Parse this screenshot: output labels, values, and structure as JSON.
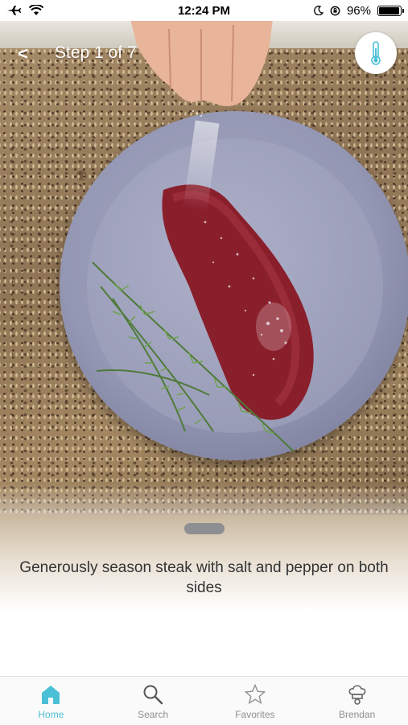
{
  "status_bar": {
    "time": "12:24 PM",
    "battery_percent": "96%",
    "battery_level": 0.96
  },
  "nav": {
    "back_label": "<",
    "title": "Step 1 of 7",
    "thermometer_icon": "thermometer-icon"
  },
  "step": {
    "instruction": "Generously season steak with salt and pepper on both sides"
  },
  "tabbar": {
    "active": "home",
    "items": [
      {
        "id": "home",
        "label": "Home",
        "icon": "home-icon"
      },
      {
        "id": "search",
        "label": "Search",
        "icon": "search-icon"
      },
      {
        "id": "favorites",
        "label": "Favorites",
        "icon": "star-icon"
      },
      {
        "id": "profile",
        "label": "Brendan",
        "icon": "chef-hat-icon"
      }
    ]
  },
  "colors": {
    "accent": "#4bbfd6",
    "inactive": "#8e8e93"
  }
}
